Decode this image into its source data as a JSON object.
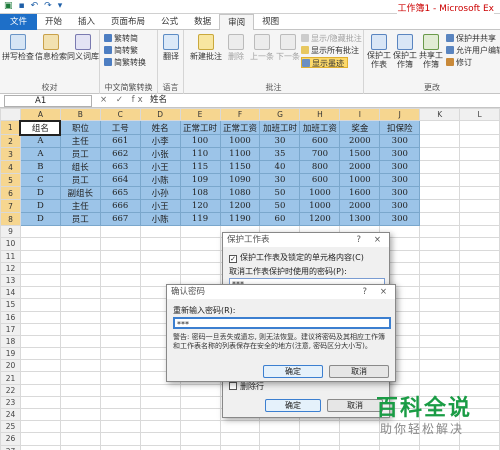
{
  "titlebar": {
    "title": "工作簿1 - Microsoft Ex"
  },
  "tabs": [
    "文件",
    "开始",
    "插入",
    "页面布局",
    "公式",
    "数据",
    "审阅",
    "视图"
  ],
  "ribbon": {
    "proofing": {
      "label": "校对",
      "buttons": [
        "拼写检查",
        "信息检索",
        "同义词库"
      ]
    },
    "chinese": {
      "label": "中文简繁转换",
      "buttons": [
        "繁转简",
        "简转繁",
        "简繁转换"
      ]
    },
    "language": {
      "label": "语言",
      "buttons": [
        "翻译"
      ]
    },
    "comments": {
      "label": "批注",
      "buttons": [
        "新建批注",
        "删除",
        "上一条",
        "下一条"
      ],
      "side": [
        "显示/隐藏批注",
        "显示所有批注",
        "显示墨迹"
      ]
    },
    "changes": {
      "label": "更改",
      "buttons": [
        "保护工作表",
        "保护工作簿",
        "共享工作簿"
      ],
      "side": [
        "保护并共享",
        "允许用户编辑",
        "修订"
      ]
    }
  },
  "formula_bar": {
    "name_box": "A1",
    "fx": "×  ✓  fx",
    "content": "姓名"
  },
  "columns": [
    "A",
    "B",
    "C",
    "D",
    "E",
    "F",
    "G",
    "H",
    "I",
    "J",
    "K",
    "L"
  ],
  "sheet": {
    "rows": [
      [
        "组名",
        "职位",
        "工号",
        "姓名",
        "正常工时",
        "正常工资",
        "加班工时",
        "加班工资",
        "奖金",
        "扣保险"
      ],
      [
        "A",
        "主任",
        "661",
        "小李",
        "100",
        "1000",
        "30",
        "600",
        "2000",
        "300"
      ],
      [
        "A",
        "员工",
        "662",
        "小张",
        "110",
        "1100",
        "35",
        "700",
        "1500",
        "300"
      ],
      [
        "B",
        "组长",
        "663",
        "小王",
        "115",
        "1150",
        "40",
        "800",
        "2000",
        "300"
      ],
      [
        "C",
        "员工",
        "664",
        "小陈",
        "109",
        "1090",
        "30",
        "600",
        "1000",
        "300"
      ],
      [
        "D",
        "副组长",
        "665",
        "小孙",
        "108",
        "1080",
        "50",
        "1000",
        "1600",
        "300"
      ],
      [
        "D",
        "主任",
        "666",
        "小王",
        "120",
        "1200",
        "50",
        "1000",
        "2000",
        "300"
      ],
      [
        "D",
        "员工",
        "667",
        "小陈",
        "119",
        "1190",
        "60",
        "1200",
        "1300",
        "300"
      ]
    ],
    "row_numbers": [
      "1",
      "2",
      "3",
      "4",
      "5",
      "6",
      "7",
      "8",
      "9",
      "10",
      "11",
      "12",
      "13",
      "14",
      "15",
      "16",
      "17",
      "18",
      "19",
      "20",
      "21",
      "22",
      "23",
      "24",
      "25",
      "26",
      "27"
    ]
  },
  "protect_dialog": {
    "title": "保护工作表",
    "check_label": "保护工作表及锁定的单元格内容(C)",
    "password_label": "取消工作表保护时使用的密码(P):",
    "password_value": "***",
    "delete_row": "删除行",
    "ok": "确定",
    "cancel": "取消"
  },
  "confirm_dialog": {
    "title": "确认密码",
    "label": "重新输入密码(R):",
    "value": "***",
    "warning": "警告: 密码一旦丢失或遗忘, 则无法恢复。建议将密码及其相应工作簿和工作表名称的列表保存在安全的地方(注意, 密码区分大小写)。",
    "ok": "确定",
    "cancel": "取消"
  },
  "watermark": {
    "big": "百科全说",
    "small": "助你轻松解决"
  },
  "colors": {
    "selection": "#9cc4e8",
    "file_tab": "#1e6fc8",
    "watermark": "#1a9c45"
  }
}
